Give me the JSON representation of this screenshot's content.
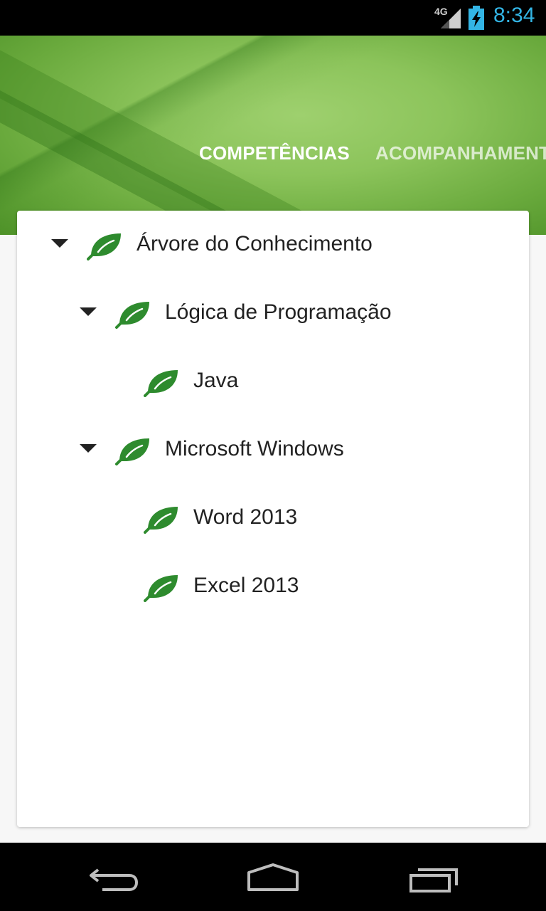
{
  "status_bar": {
    "network": "4G",
    "time": "8:34",
    "icons": [
      "signal-icon",
      "battery-icon"
    ]
  },
  "header": {
    "tabs": [
      {
        "label": "COMPETÊNCIAS",
        "active": true
      },
      {
        "label": "ACOMPANHAMENTO",
        "active": false
      }
    ]
  },
  "tree": {
    "items": [
      {
        "label": "Árvore do Conhecimento",
        "level": 0,
        "expanded": true
      },
      {
        "label": "Lógica de Programação",
        "level": 1,
        "expanded": true
      },
      {
        "label": "Java",
        "level": 2,
        "expanded": false
      },
      {
        "label": "Microsoft Windows",
        "level": 1,
        "expanded": true
      },
      {
        "label": "Word 2013",
        "level": 2,
        "expanded": false
      },
      {
        "label": "Excel 2013",
        "level": 2,
        "expanded": false
      }
    ]
  },
  "nav_bar": {
    "icons": [
      "back-icon",
      "home-icon",
      "recent-apps-icon"
    ]
  },
  "colors": {
    "accent": "#33b5e5",
    "leaf_green": "#2e8b2e",
    "header_green": "#8cc45b"
  }
}
